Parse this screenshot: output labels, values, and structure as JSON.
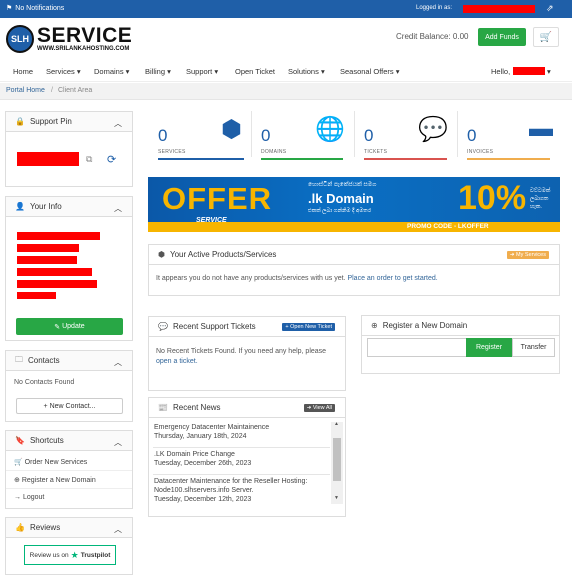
{
  "topbar": {
    "notifications": "No Notifications",
    "logged_in_as": "Logged in as:"
  },
  "brand": {
    "name": "SERVICE",
    "url": "WWW.SRILANKAHOSTING.COM",
    "badge": "SLH"
  },
  "header": {
    "credit": "Credit Balance: 0.00",
    "add_funds": "Add Funds",
    "cart_count": "0"
  },
  "nav": {
    "items": [
      "Home",
      "Services",
      "Domains",
      "Billing",
      "Support",
      "Open Ticket",
      "Solutions",
      "Seasonal Offers"
    ],
    "hello": "Hello,"
  },
  "breadcrumb": {
    "home": "Portal Home",
    "sep": "/",
    "current": "Client Area"
  },
  "sidebar": {
    "support_pin": {
      "title": "Support Pin"
    },
    "your_info": {
      "title": "Your Info",
      "update": "Update"
    },
    "contacts": {
      "title": "Contacts",
      "empty": "No Contacts Found",
      "new": "New Contact..."
    },
    "shortcuts": {
      "title": "Shortcuts",
      "items": [
        "Order New Services",
        "Register a New Domain",
        "Logout"
      ]
    },
    "reviews": {
      "title": "Reviews",
      "review_text": "Review us on",
      "brand": "Trustpilot"
    }
  },
  "stats": [
    {
      "value": "0",
      "label": "SERVICES",
      "color": "#1f5fa8"
    },
    {
      "value": "0",
      "label": "DOMAINS",
      "color": "#28a745"
    },
    {
      "value": "0",
      "label": "TICKETS",
      "color": "#d9534f"
    },
    {
      "value": "0",
      "label": "INVOICES",
      "color": "#f0ad4e"
    }
  ],
  "banner": {
    "offer": "OFFER",
    "sinhala_top": "හොස්ටින් පැකේජයක් සමග",
    "domain": ".lk Domain",
    "sinhala_bottom": "එකක් ලබා ගන්නිම දී අමතර",
    "percent": "10%",
    "side_text": "වට්ටමක් ලබාගත හැක.",
    "promo": "PROMO CODE - LKOFFER",
    "logo": "SERVICE"
  },
  "products": {
    "title": "Your Active Products/Services",
    "tag": "My Services",
    "empty": "It appears you do not have any products/services with us yet.",
    "link": "Place an order to get started."
  },
  "tickets": {
    "title": "Recent Support Tickets",
    "tag": "Open New Ticket",
    "empty": "No Recent Tickets Found. If you need any help, please",
    "link": "open a ticket."
  },
  "domain_reg": {
    "title": "Register a New Domain",
    "register": "Register",
    "transfer": "Transfer"
  },
  "news": {
    "title": "Recent News",
    "tag": "View All",
    "items": [
      {
        "title": "Emergency Datacenter Maintainence",
        "date": "Thursday, January 18th, 2024"
      },
      {
        "title": ".LK Domain Price Change",
        "date": "Tuesday, December 26th, 2023"
      },
      {
        "title": "Datacenter Maintenance for the Reseller Hosting: Node100.slhservers.info Server.",
        "date": "Tuesday, December 12th, 2023"
      }
    ]
  },
  "colors": {
    "brand_blue": "#1f5fa8",
    "green": "#28a745",
    "redacted": "#ff0000"
  }
}
